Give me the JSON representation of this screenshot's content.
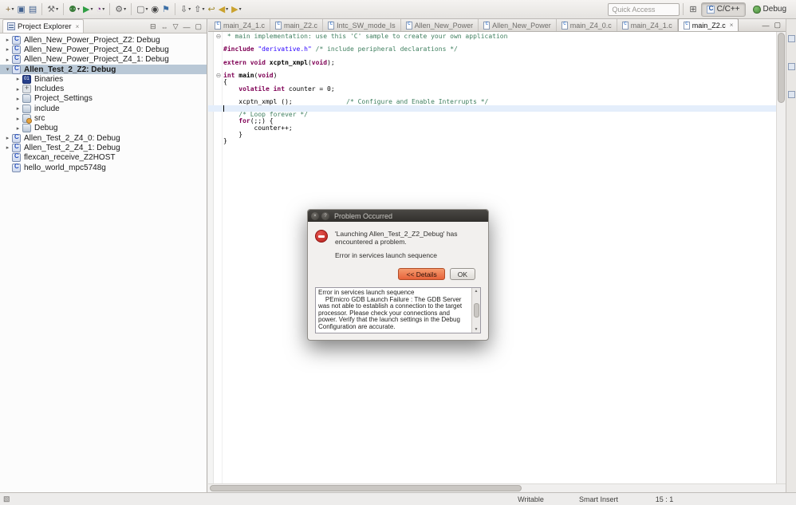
{
  "toolbar": {
    "quick_access_placeholder": "Quick Access",
    "icons": [
      {
        "name": "new",
        "glyph": "+",
        "color": "#8a6d3b",
        "dd": true
      },
      {
        "name": "save",
        "glyph": "▣",
        "color": "#41618f"
      },
      {
        "name": "save-all",
        "glyph": "▤",
        "color": "#41618f"
      },
      {
        "sep": true
      },
      {
        "name": "build",
        "glyph": "⚒",
        "color": "#6d6d6d",
        "dd": true
      },
      {
        "sep": true
      },
      {
        "name": "debug",
        "glyph": "⚉",
        "color": "#3b7d3b",
        "dd": true
      },
      {
        "name": "run",
        "glyph": "▶",
        "color": "#2f9e44",
        "dd": true
      },
      {
        "name": "profile",
        "glyph": "◔",
        "color": "#7b2d8b",
        "dd": true
      },
      {
        "sep": true
      },
      {
        "name": "external-tools",
        "glyph": "⚙",
        "color": "#5f5f5f",
        "dd": true
      },
      {
        "sep": true
      },
      {
        "name": "new-c-file",
        "glyph": "▢",
        "color": "#666666",
        "dd": true
      },
      {
        "name": "search",
        "glyph": "◉",
        "color": "#444444"
      },
      {
        "name": "toggle-breakpoint",
        "glyph": "⚑",
        "color": "#3b6ea5"
      },
      {
        "sep": true
      },
      {
        "name": "next-annotation",
        "glyph": "⇩",
        "color": "#555555",
        "dd": true
      },
      {
        "name": "previous-annotation",
        "glyph": "⇧",
        "color": "#555555",
        "dd": true
      },
      {
        "name": "last-edit-location",
        "glyph": "↩",
        "color": "#a0892c"
      },
      {
        "name": "back",
        "glyph": "◀",
        "color": "#caa22e",
        "dd": true
      },
      {
        "name": "forward",
        "glyph": "▶",
        "color": "#caa22e",
        "dd": true
      }
    ],
    "perspectives": [
      {
        "label": "C/C++",
        "icon": "cpp",
        "active": true
      },
      {
        "label": "Debug",
        "icon": "bug",
        "active": false
      }
    ]
  },
  "project_explorer": {
    "title": "Project Explorer",
    "items": [
      {
        "label": "Allen_New_Power_Project_Z2: Debug",
        "type": "project",
        "arrow": "collapsed",
        "level": 0
      },
      {
        "label": "Allen_New_Power_Project_Z4_0: Debug",
        "type": "project",
        "arrow": "collapsed",
        "level": 0
      },
      {
        "label": "Allen_New_Power_Project_Z4_1: Debug",
        "type": "project",
        "arrow": "collapsed",
        "level": 0
      },
      {
        "label": "Allen_Test_2_Z2: Debug",
        "type": "project",
        "arrow": "expanded",
        "level": 0,
        "selected": true,
        "bold": true
      },
      {
        "label": "Binaries",
        "type": "binaries",
        "arrow": "collapsed",
        "level": 1
      },
      {
        "label": "Includes",
        "type": "includes",
        "arrow": "collapsed",
        "level": 1
      },
      {
        "label": "Project_Settings",
        "type": "folder",
        "arrow": "collapsed",
        "level": 1
      },
      {
        "label": "include",
        "type": "folder",
        "arrow": "collapsed",
        "level": 1
      },
      {
        "label": "src",
        "type": "src",
        "arrow": "collapsed",
        "level": 1
      },
      {
        "label": "Debug",
        "type": "folder",
        "arrow": "collapsed",
        "level": 1
      },
      {
        "label": "Allen_Test_2_Z4_0: Debug",
        "type": "project",
        "arrow": "collapsed",
        "level": 0
      },
      {
        "label": "Allen_Test_2_Z4_1: Debug",
        "type": "project",
        "arrow": "collapsed",
        "level": 0
      },
      {
        "label": "flexcan_receive_Z2HOST",
        "type": "project-closed",
        "arrow": null,
        "level": 0
      },
      {
        "label": "hello_world_mpc5748g",
        "type": "project-closed",
        "arrow": null,
        "level": 0
      }
    ]
  },
  "editor": {
    "tabs": [
      {
        "label": "main_Z4_1.c",
        "active": false
      },
      {
        "label": "main_Z2.c",
        "active": false
      },
      {
        "label": "Intc_SW_mode_Is",
        "active": false
      },
      {
        "label": "Allen_New_Power",
        "active": false
      },
      {
        "label": "Allen_New_Power",
        "active": false
      },
      {
        "label": "main_Z4_0.c",
        "active": false
      },
      {
        "label": "main_Z4_1.c",
        "active": false
      },
      {
        "label": "main_Z2.c",
        "active": true
      }
    ],
    "current_line": 11,
    "fold_lines": [
      0,
      6
    ],
    "lines": [
      [
        [
          "c",
          " * main implementation: use this 'C' sample to create your own application"
        ]
      ],
      [],
      [
        [
          "k",
          "#include "
        ],
        [
          "s",
          "\"derivative.h\""
        ],
        [
          "p",
          " "
        ],
        [
          "c",
          "/* include peripheral declarations */"
        ]
      ],
      [],
      [
        [
          "k",
          "extern void "
        ],
        [
          "f",
          "xcptn_xmpl"
        ],
        [
          "p",
          "("
        ],
        [
          "k",
          "void"
        ],
        [
          "p",
          ");"
        ]
      ],
      [],
      [
        [
          "k",
          "int "
        ],
        [
          "f",
          "main"
        ],
        [
          "p",
          "("
        ],
        [
          "k",
          "void"
        ],
        [
          "p",
          ")"
        ]
      ],
      [
        [
          "p",
          "{"
        ]
      ],
      [
        [
          "p",
          "    "
        ],
        [
          "k",
          "volatile int "
        ],
        [
          "p",
          "counter = 0;"
        ]
      ],
      [],
      [
        [
          "p",
          "    xcptn_xmpl ();              "
        ],
        [
          "c",
          "/* Configure and Enable Interrupts */"
        ]
      ],
      [],
      [
        [
          "p",
          "    "
        ],
        [
          "c",
          "/* Loop forever */"
        ]
      ],
      [
        [
          "p",
          "    "
        ],
        [
          "k",
          "for"
        ],
        [
          "p",
          "(;;) {"
        ]
      ],
      [
        [
          "p",
          "        counter++;"
        ]
      ],
      [
        [
          "p",
          "    }"
        ]
      ],
      [
        [
          "p",
          "}"
        ]
      ]
    ]
  },
  "dialog": {
    "title": "Problem Occurred",
    "message_line1": "'Launching Allen_Test_2_Z2_Debug' has encountered a problem.",
    "message_line2": "Error in services launch sequence",
    "details_button": "<< Details",
    "ok_button": "OK",
    "details_text": "Error in services launch sequence\n    PEmicro GDB Launch Failure : The GDB Server was not able to establish a connection to the target processor. Please check your connections and power. Verify that the launch settings in the Debug Configuration are accurate."
  },
  "status_bar": {
    "writable": "Writable",
    "insert_mode": "Smart Insert",
    "position": "15 : 1"
  }
}
